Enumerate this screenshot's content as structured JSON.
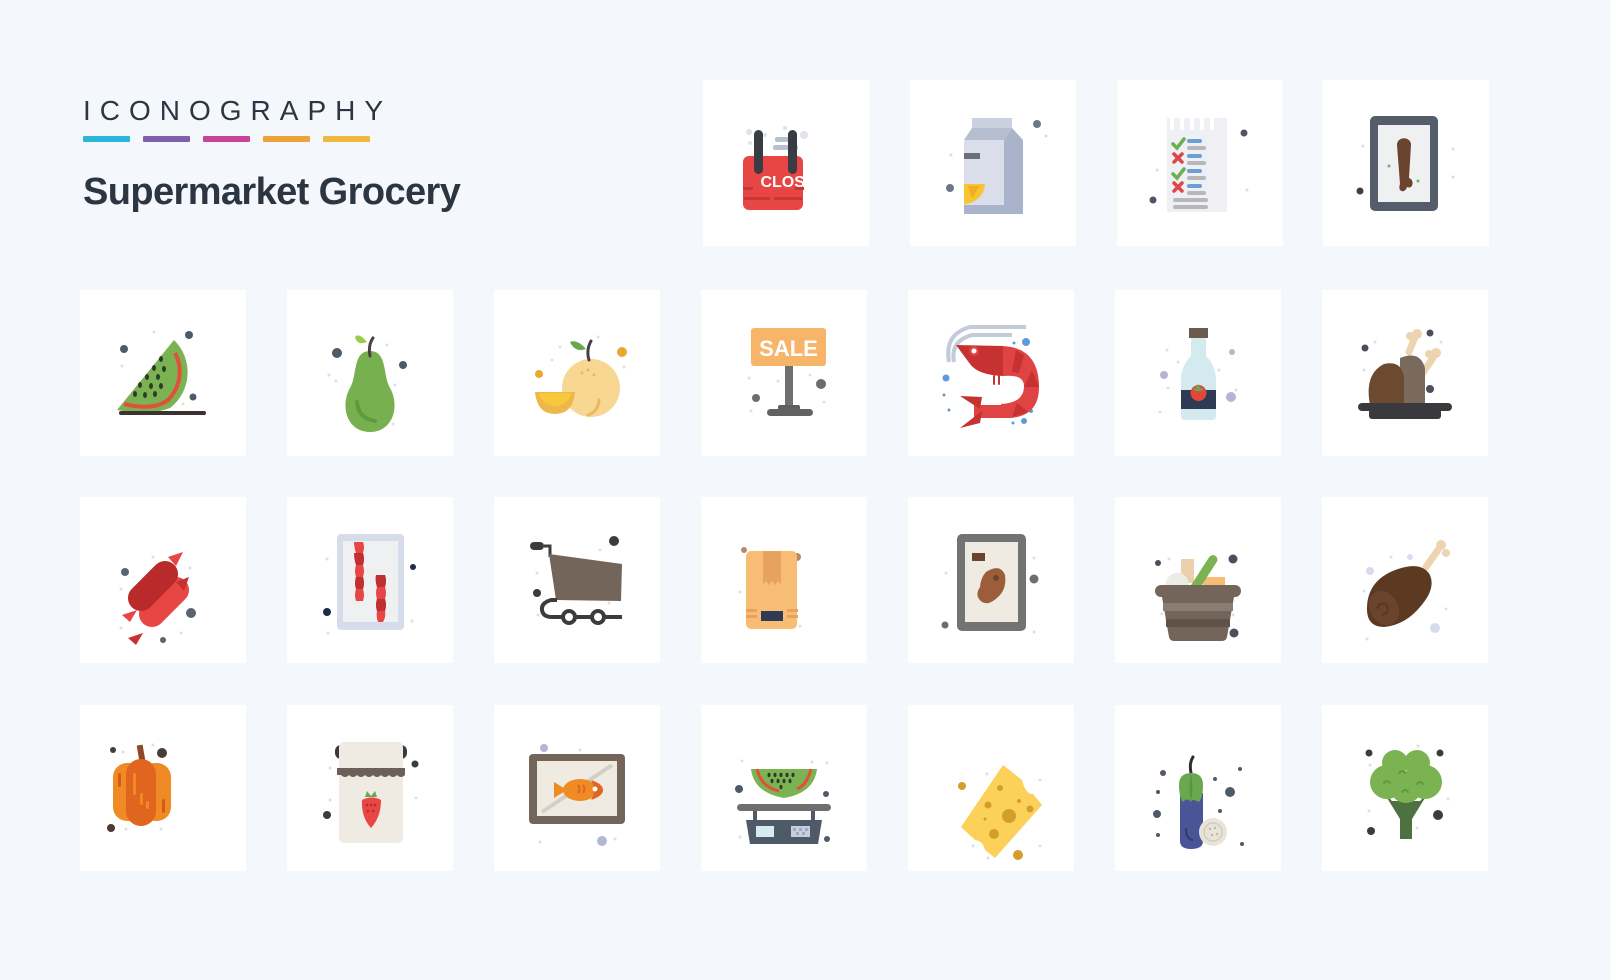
{
  "header": {
    "kicker": "ICONOGRAPHY",
    "title": "Supermarket Grocery",
    "accent_colors": [
      "#29b6d8",
      "#7e5fb0",
      "#c8439a",
      "#eea23b",
      "#f2b73e"
    ]
  },
  "icon_set": {
    "count": 25,
    "style": "flat",
    "icons": [
      {
        "name": "close-sign-icon",
        "label_text": "CLOSE"
      },
      {
        "name": "milk-carton-icon"
      },
      {
        "name": "checklist-icon"
      },
      {
        "name": "chicken-leg-tray-icon"
      },
      {
        "name": "watermelon-slice-icon"
      },
      {
        "name": "pear-icon"
      },
      {
        "name": "grapefruit-icon"
      },
      {
        "name": "sale-sign-icon",
        "label_text": "SALE"
      },
      {
        "name": "shrimp-icon"
      },
      {
        "name": "ketchup-bottle-icon"
      },
      {
        "name": "roast-chicken-icon"
      },
      {
        "name": "sausages-icon"
      },
      {
        "name": "bacon-pack-icon"
      },
      {
        "name": "shopping-cart-icon"
      },
      {
        "name": "cardboard-box-icon"
      },
      {
        "name": "meat-package-icon"
      },
      {
        "name": "grocery-basket-icon"
      },
      {
        "name": "ham-leg-icon"
      },
      {
        "name": "pumpkin-icon"
      },
      {
        "name": "strawberry-jam-icon"
      },
      {
        "name": "fish-package-icon"
      },
      {
        "name": "weighing-scale-icon"
      },
      {
        "name": "cheese-icon"
      },
      {
        "name": "eggplant-icon"
      },
      {
        "name": "broccoli-icon"
      }
    ]
  }
}
